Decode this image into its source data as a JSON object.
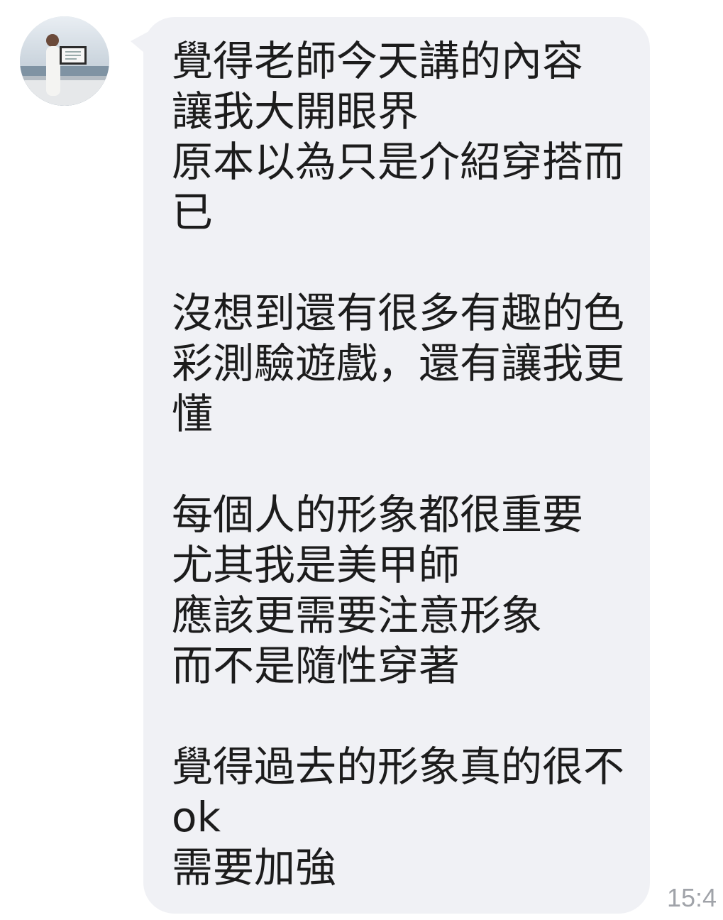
{
  "chat": {
    "avatar_icon": "user-avatar-photo",
    "colors": {
      "bubble_background": "#f0f1f5",
      "message_text": "#1c1c1c",
      "timestamp_text": "#a0a3a9"
    },
    "message": {
      "lines": [
        "覺得老師今天講的內容",
        "讓我大開眼界",
        "原本以為只是介紹穿搭而",
        "已",
        "",
        "沒想到還有很多有趣的色",
        "彩測驗遊戲，還有讓我更",
        "懂",
        "",
        "每個人的形象都很重要",
        "尤其我是美甲師",
        "應該更需要注意形象",
        "而不是隨性穿著",
        "",
        "覺得過去的形象真的很不",
        "ok",
        "需要加強"
      ],
      "timestamp": "15:4"
    }
  }
}
